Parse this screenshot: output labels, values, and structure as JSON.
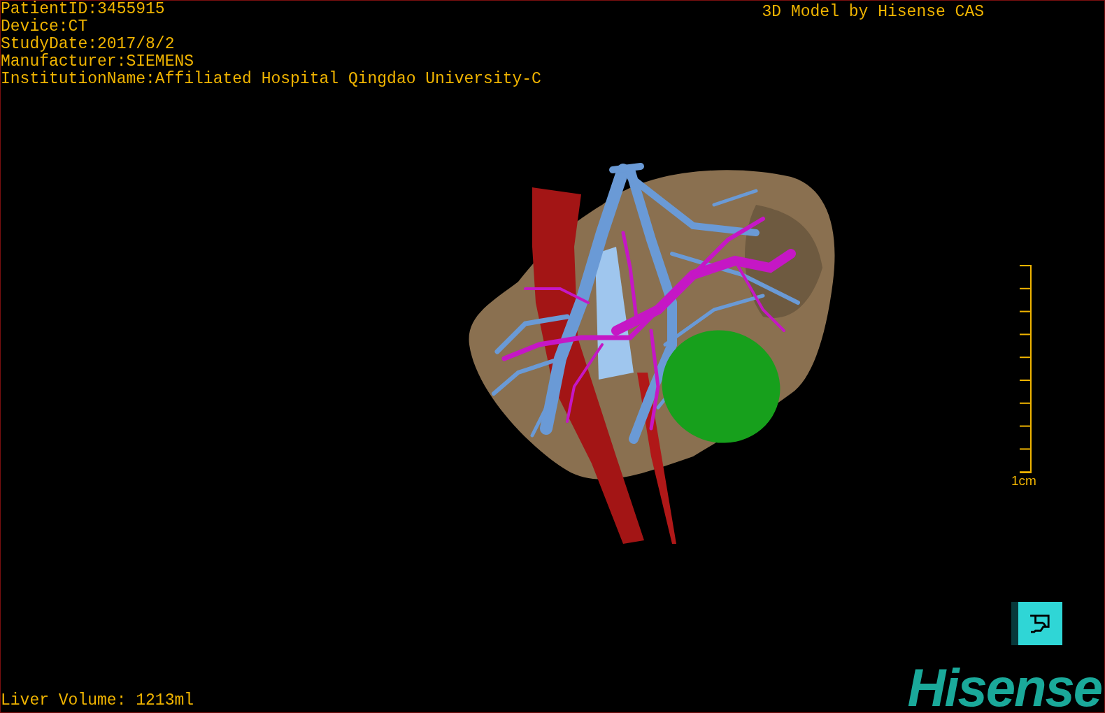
{
  "info_lines": [
    "PatientID:3455915",
    "Device:CT",
    "StudyDate:2017/8/2",
    "Manufacturer:SIEMENS",
    "InstitutionName:Affiliated Hospital Qingdao University-C"
  ],
  "caption": "3D Model by Hisense CAS",
  "scale_bar": {
    "label": "1cm"
  },
  "logo": {
    "text": "Hisense"
  },
  "liver_volume": "Liver Volume: 1213ml"
}
